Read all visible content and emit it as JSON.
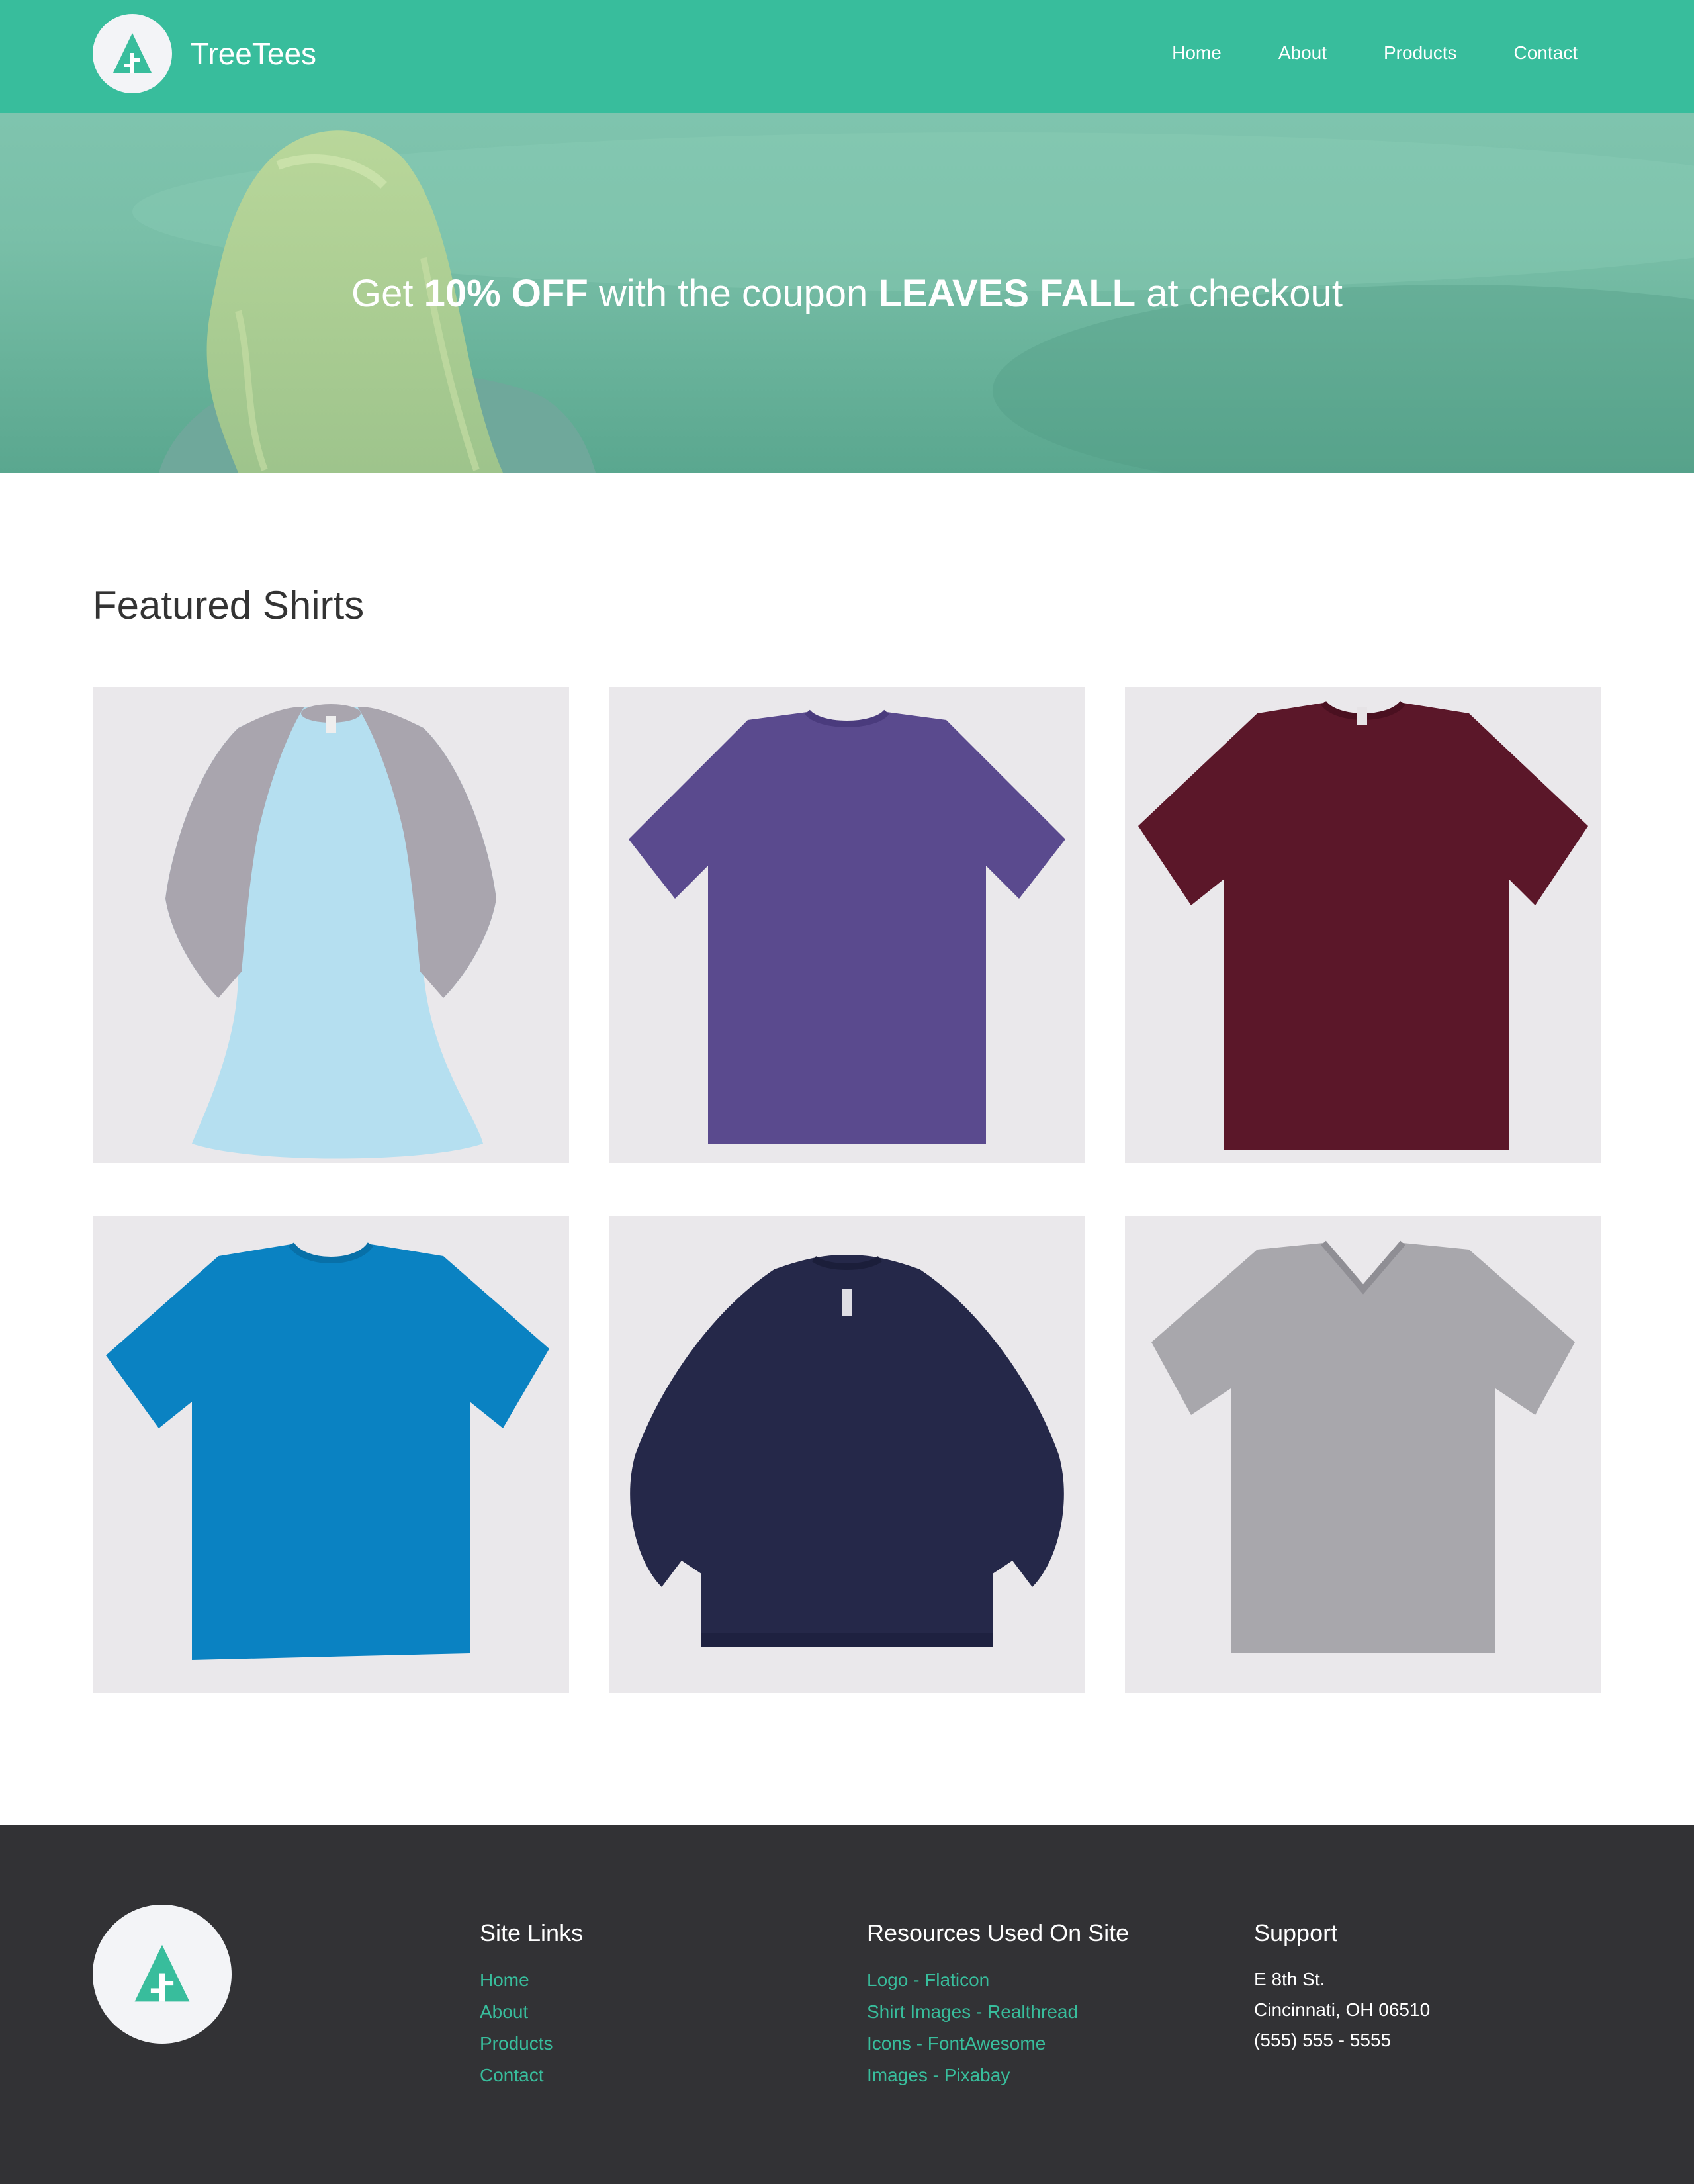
{
  "header": {
    "brand": "TreeTees",
    "nav": [
      "Home",
      "About",
      "Products",
      "Contact"
    ]
  },
  "hero": {
    "pre": "Get ",
    "discount": "10% OFF",
    "mid": " with the coupon ",
    "coupon": "LEAVES FALL",
    "post": " at checkout"
  },
  "featured": {
    "title": "Featured Shirts",
    "shirts": [
      {
        "style": "raglan",
        "colors": {
          "body": "#b5dff0",
          "sleeve": "#a9a5ae"
        }
      },
      {
        "style": "tee",
        "colors": {
          "body": "#5a4a8e"
        }
      },
      {
        "style": "tee",
        "colors": {
          "body": "#5b1729"
        }
      },
      {
        "style": "tee",
        "colors": {
          "body": "#0a82c2"
        }
      },
      {
        "style": "sweatshirt",
        "colors": {
          "body": "#252849"
        }
      },
      {
        "style": "vneck",
        "colors": {
          "body": "#a8a7ac"
        }
      }
    ]
  },
  "footer": {
    "site_links": {
      "title": "Site Links",
      "links": [
        "Home",
        "About",
        "Products",
        "Contact"
      ]
    },
    "resources": {
      "title": "Resources Used On Site",
      "links": [
        "Logo - Flaticon",
        "Shirt Images - Realthread",
        "Icons - FontAwesome",
        "Images - Pixabay"
      ]
    },
    "support": {
      "title": "Support",
      "lines": [
        "E 8th St.",
        "Cincinnati, OH 06510",
        "(555) 555 - 5555"
      ]
    }
  },
  "colors": {
    "brand": "#38bd9c",
    "footer_bg": "#323235",
    "card_bg": "#eae8eb"
  },
  "icons": {
    "logo": "tree-logo-icon"
  }
}
